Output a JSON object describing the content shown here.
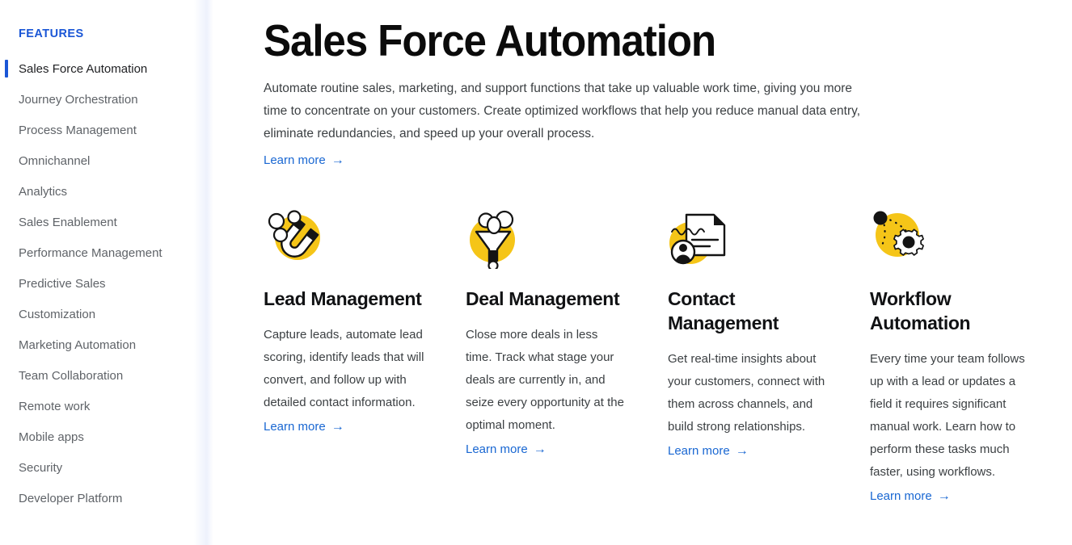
{
  "sidebar": {
    "section_label": "FEATURES",
    "accent_color": "#1a56d6",
    "items": [
      {
        "label": "Sales Force Automation",
        "active": true
      },
      {
        "label": "Journey Orchestration",
        "active": false
      },
      {
        "label": "Process Management",
        "active": false
      },
      {
        "label": "Omnichannel",
        "active": false
      },
      {
        "label": "Analytics",
        "active": false
      },
      {
        "label": "Sales Enablement",
        "active": false
      },
      {
        "label": "Performance Management",
        "active": false
      },
      {
        "label": "Predictive Sales",
        "active": false
      },
      {
        "label": "Customization",
        "active": false
      },
      {
        "label": "Marketing Automation",
        "active": false
      },
      {
        "label": "Team Collaboration",
        "active": false
      },
      {
        "label": "Remote work",
        "active": false
      },
      {
        "label": "Mobile apps",
        "active": false
      },
      {
        "label": "Security",
        "active": false
      },
      {
        "label": "Developer Platform",
        "active": false
      }
    ]
  },
  "main": {
    "title": "Sales Force Automation",
    "intro": "Automate routine sales, marketing, and support functions that take up valuable work time, giving you more time to concentrate on your customers. Create optimized workflows that help you reduce manual data entry, eliminate redundancies, and speed up your overall process.",
    "learn_more_label": "Learn more",
    "learn_more_arrow": "→",
    "link_color": "#1967d2",
    "icon_accent_color": "#F5C518",
    "cards": [
      {
        "icon": "magnet-icon",
        "title": "Lead Management",
        "body": "Capture leads, automate lead scoring, identify leads that will convert, and follow up with detailed contact information.",
        "learn_more_label": "Learn more",
        "learn_more_arrow": "→"
      },
      {
        "icon": "funnel-icon",
        "title": "Deal Management",
        "body": "Close more deals in less time. Track what stage your deals are currently in, and seize every opportunity at the optimal moment.",
        "learn_more_label": "Learn more",
        "learn_more_arrow": "→"
      },
      {
        "icon": "contact-document-icon",
        "title": "Contact Management",
        "body": "Get real-time insights about your customers, connect with them across channels, and build strong relationships.",
        "learn_more_label": "Learn more",
        "learn_more_arrow": "→"
      },
      {
        "icon": "gear-workflow-icon",
        "title": "Workflow Automation",
        "body": "Every time your team follows up with a lead or updates a field it requires significant manual work. Learn how to perform these tasks much faster, using workflows.",
        "learn_more_label": "Learn more",
        "learn_more_arrow": "→"
      }
    ]
  }
}
